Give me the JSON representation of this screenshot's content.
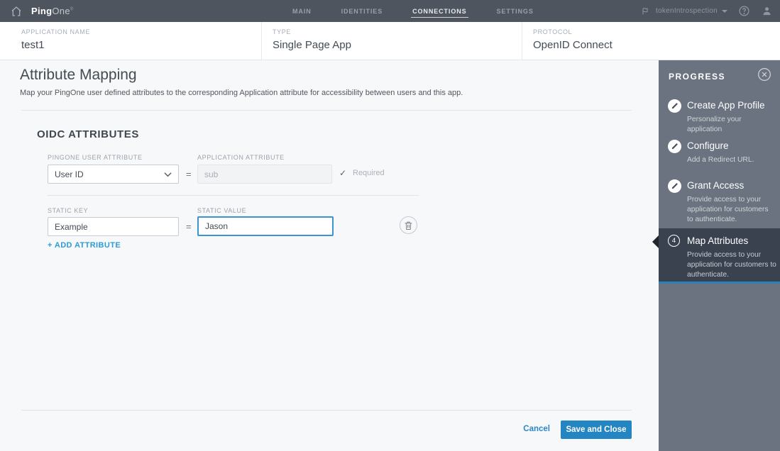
{
  "topbar": {
    "brand": {
      "ping": "Ping",
      "one": "One",
      "tm": "®"
    },
    "nav": [
      {
        "label": "MAIN",
        "active": false
      },
      {
        "label": "IDENTITIES",
        "active": false
      },
      {
        "label": "CONNECTIONS",
        "active": true
      },
      {
        "label": "SETTINGS",
        "active": false
      }
    ],
    "environment": {
      "label": "tokenIntrospection"
    }
  },
  "app_header": {
    "fields": [
      {
        "label": "APPLICATION NAME",
        "value": "test1"
      },
      {
        "label": "TYPE",
        "value": "Single Page App"
      },
      {
        "label": "PROTOCOL",
        "value": "OpenID Connect"
      }
    ]
  },
  "main": {
    "title": "Attribute Mapping",
    "subtitle": "Map your PingOne user defined attributes to the corresponding Application attribute for accessibility between users and this app.",
    "section_heading": "OIDC ATTRIBUTES",
    "oidc_row": {
      "label_left": "PINGONE USER ATTRIBUTE",
      "value_left": "User ID",
      "equals": "=",
      "label_right": "APPLICATION ATTRIBUTE",
      "value_right": "sub",
      "check": "✓",
      "required_label": "Required"
    },
    "static_row": {
      "label_left": "STATIC KEY",
      "value_left": "Example",
      "equals": "=",
      "label_right": "STATIC VALUE",
      "value_right": "Jason"
    },
    "add_attribute_label": "+ ADD ATTRIBUTE",
    "footer": {
      "cancel_label": "Cancel",
      "save_label": "Save and Close"
    }
  },
  "progress": {
    "title": "PROGRESS",
    "steps": [
      {
        "title": "Create App Profile",
        "description": "Personalize your application",
        "state": "complete"
      },
      {
        "title": "Configure",
        "description": "Add a Redirect URL.",
        "state": "complete"
      },
      {
        "title": "Grant Access",
        "description": "Provide access to your application for customers to authenticate.",
        "state": "complete"
      },
      {
        "title": "Map Attributes",
        "description": "Provide access to your application for customers to authenticate.",
        "number": "4",
        "state": "active"
      }
    ]
  },
  "icons": {
    "home": "house-outline",
    "environment": "flag",
    "dropdown": "caret-down",
    "help": "question-circle",
    "account": "person",
    "select_chevron": "chevron-down",
    "delete": "trash",
    "close": "x-circle",
    "step_complete": "pencil-circle"
  },
  "colors": {
    "topbar_bg": "#4e555f",
    "panel_bg": "#6b7380",
    "active_step_bg": "#3a4250",
    "progress_accent": "#2f80b8",
    "primary_button": "#2386c2",
    "link_blue": "#2e9bd6",
    "focus_border": "#3a95d2"
  }
}
